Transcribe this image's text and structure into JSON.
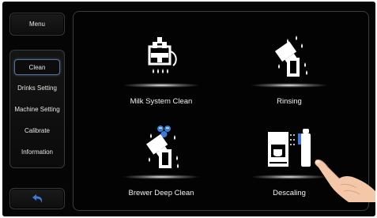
{
  "sidebar": {
    "menu_label": "Menu",
    "items": [
      {
        "label": "Clean",
        "active": true
      },
      {
        "label": "Drinks Setting",
        "active": false
      },
      {
        "label": "Machine Setting",
        "active": false
      },
      {
        "label": "Calibrate",
        "active": false
      },
      {
        "label": "Information",
        "active": false
      }
    ],
    "back_icon": "back-arrow-icon"
  },
  "tiles": [
    {
      "label": "Milk System Clean",
      "icon": "milk-system-icon"
    },
    {
      "label": "Rinsing",
      "icon": "rinsing-icon"
    },
    {
      "label": "Brewer Deep Clean",
      "icon": "brewer-deep-clean-icon"
    },
    {
      "label": "Descaling",
      "icon": "descaling-icon"
    }
  ],
  "colors": {
    "background": "#050505",
    "accent_blue": "#3b7bd6",
    "text": "#f2f2f2"
  }
}
